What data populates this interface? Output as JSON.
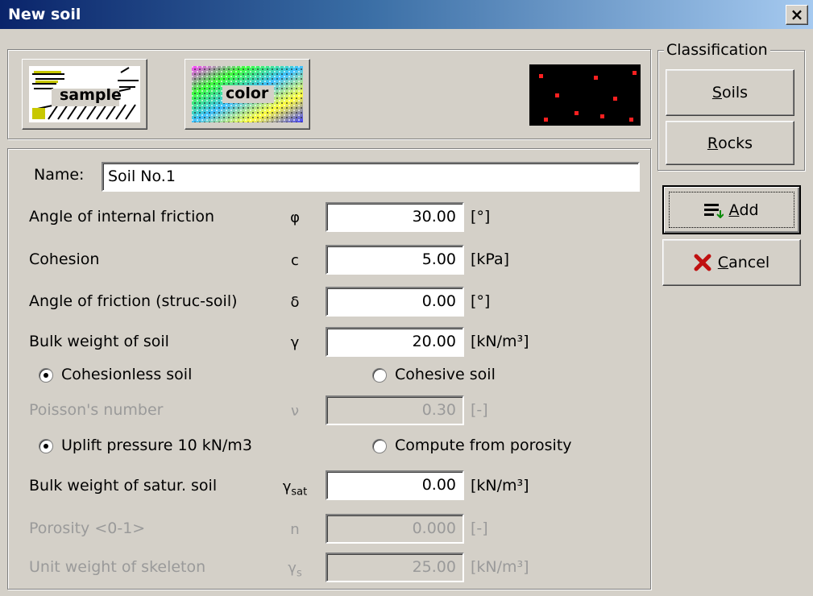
{
  "window": {
    "title": "New soil"
  },
  "pattern_buttons": {
    "sample_label": "sample",
    "color_label": "color"
  },
  "classification": {
    "title": "Classification",
    "soils": {
      "first": "S",
      "rest": "oils"
    },
    "rocks": {
      "first": "R",
      "rest": "ocks"
    }
  },
  "actions": {
    "add": {
      "first": "A",
      "rest": "dd"
    },
    "cancel": {
      "first": "C",
      "rest": "ancel"
    }
  },
  "form": {
    "name_label": "Name:",
    "name_value": "Soil No.1",
    "rows": {
      "friction": {
        "label": "Angle of internal friction",
        "symbol": "φ",
        "value": "30.00",
        "unit": "[°]"
      },
      "cohesion": {
        "label": "Cohesion",
        "symbol": "c",
        "value": "5.00",
        "unit": "[kPa]"
      },
      "struc_friction": {
        "label": "Angle of friction (struc-soil)",
        "symbol": "δ",
        "value": "0.00",
        "unit": "[°]"
      },
      "bulk_weight": {
        "label": "Bulk weight of soil",
        "symbol": "γ",
        "value": "20.00",
        "unit": "[kN/m³]"
      },
      "poisson": {
        "label": "Poisson's number",
        "symbol": "ν",
        "value": "0.30",
        "unit": "[-]"
      },
      "bulk_satur": {
        "label": "Bulk weight of satur. soil",
        "symbol": "γ",
        "sub": "sat",
        "value": "0.00",
        "unit": "[kN/m³]"
      },
      "porosity": {
        "label": "Porosity <0-1>",
        "symbol": "n",
        "value": "0.000",
        "unit": "[-]"
      },
      "skeleton": {
        "label": "Unit weight of skeleton",
        "symbol": "γ",
        "sub": "s",
        "value": "25.00",
        "unit": "[kN/m³]"
      }
    },
    "radio_soil": {
      "cohesionless": "Cohesionless soil",
      "cohesive": "Cohesive soil",
      "selected": "cohesionless"
    },
    "radio_uplift": {
      "uplift": "Uplift pressure 10 kN/m3",
      "porosity": "Compute from porosity",
      "selected": "uplift"
    }
  },
  "colors": {
    "title_start": "#0a246a",
    "title_end": "#a6caf0",
    "face": "#d4d0c8",
    "preview_dot": "#ff2020"
  }
}
